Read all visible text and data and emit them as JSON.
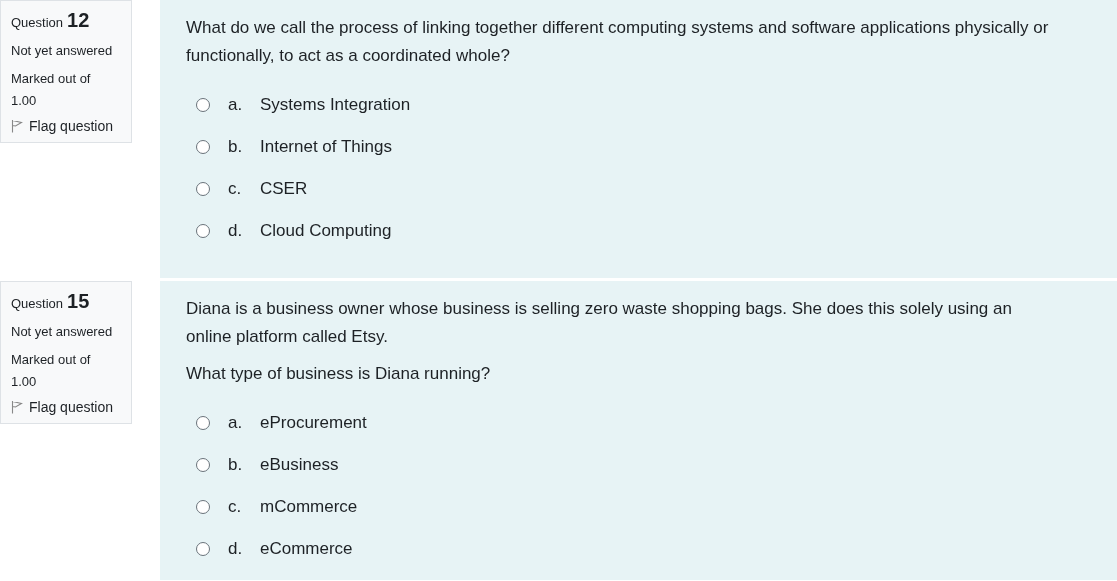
{
  "questions": [
    {
      "label": "Question",
      "number": "12",
      "status": "Not yet answered",
      "marks": "Marked out of 1.00",
      "flag": "Flag question",
      "paragraphs": [
        "What do we call the process of linking together different computing systems and software applications physically or functionally, to act as a coordinated whole?"
      ],
      "options": [
        {
          "letter": "a.",
          "text": "Systems Integration",
          "selected": false
        },
        {
          "letter": "b.",
          "text": "Internet of Things",
          "selected": false
        },
        {
          "letter": "c.",
          "text": "CSER",
          "selected": false
        },
        {
          "letter": "d.",
          "text": "Cloud Computing",
          "selected": false
        }
      ]
    },
    {
      "label": "Question",
      "number": "15",
      "status": "Not yet answered",
      "marks": "Marked out of 1.00",
      "flag": "Flag question",
      "paragraphs": [
        "Diana is a business owner whose business is selling zero waste shopping bags. She does this solely using an online platform called Etsy.",
        "What type of business is Diana running?"
      ],
      "options": [
        {
          "letter": "a.",
          "text": "eProcurement",
          "selected": false
        },
        {
          "letter": "b.",
          "text": "eBusiness",
          "selected": false
        },
        {
          "letter": "c.",
          "text": "mCommerce",
          "selected": false
        },
        {
          "letter": "d.",
          "text": "eCommerce",
          "selected": false
        }
      ]
    }
  ]
}
